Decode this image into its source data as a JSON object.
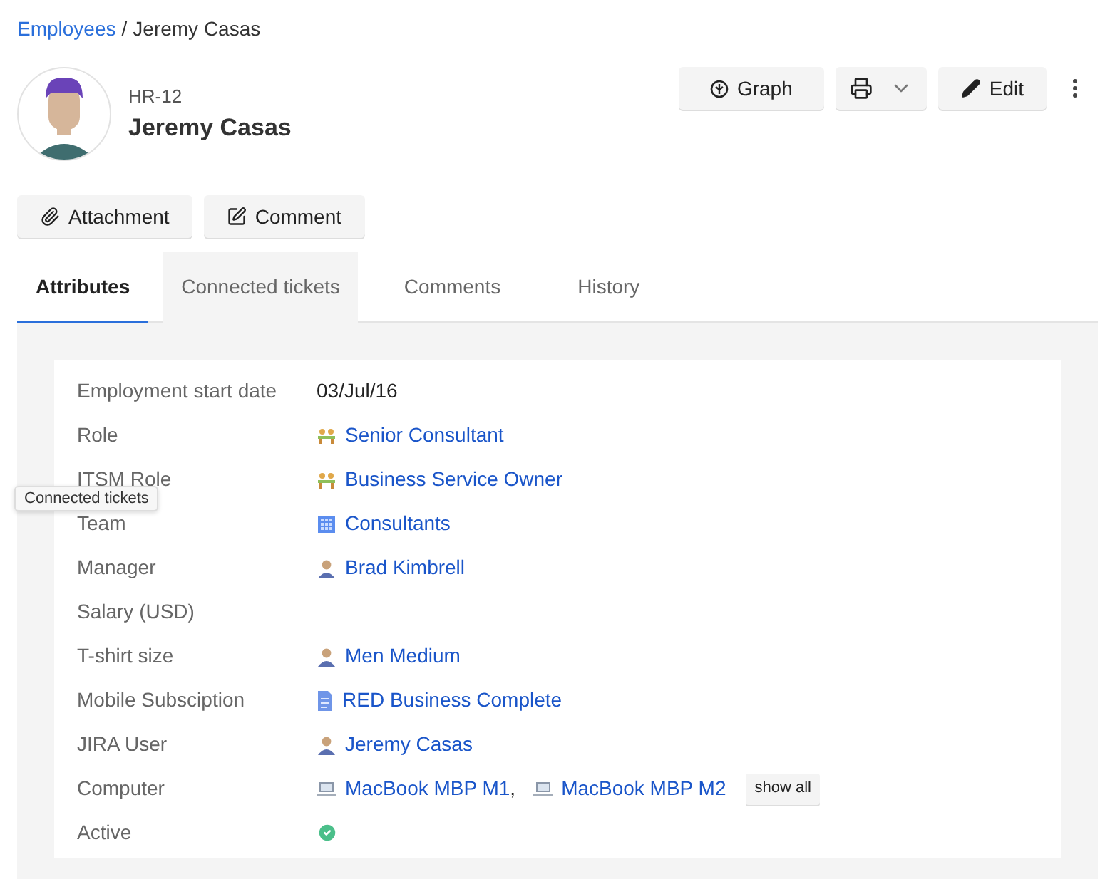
{
  "breadcrumb": {
    "link": "Employees",
    "separator": "/",
    "current": "Jeremy Casas"
  },
  "header": {
    "key": "HR-12",
    "name": "Jeremy Casas"
  },
  "toolbar": {
    "graph": "Graph",
    "edit": "Edit"
  },
  "actions": [
    "Attachment",
    "Comment"
  ],
  "tabs": [
    {
      "label": "Attributes",
      "selected": true,
      "hovered": false
    },
    {
      "label": "Connected tickets",
      "selected": false,
      "hovered": true
    },
    {
      "label": "Comments",
      "selected": false,
      "hovered": false
    },
    {
      "label": "History",
      "selected": false,
      "hovered": false
    }
  ],
  "tooltip": "Connected tickets",
  "attributes": [
    {
      "label": "Employment start date",
      "kind": "text",
      "value": "03/Jul/16"
    },
    {
      "label": "Role",
      "kind": "links",
      "links": [
        {
          "kind": "role",
          "text": "Senior Consultant"
        }
      ]
    },
    {
      "label": "ITSM Role",
      "kind": "links",
      "links": [
        {
          "kind": "role",
          "text": "Business Service Owner"
        }
      ]
    },
    {
      "label": "Team",
      "kind": "links",
      "links": [
        {
          "kind": "team",
          "text": "Consultants"
        }
      ]
    },
    {
      "label": "Manager",
      "kind": "links",
      "links": [
        {
          "kind": "person",
          "text": "Brad Kimbrell"
        }
      ]
    },
    {
      "label": "Salary (USD)",
      "kind": "empty"
    },
    {
      "label": "T-shirt size",
      "kind": "links",
      "links": [
        {
          "kind": "person",
          "text": "Men Medium"
        }
      ]
    },
    {
      "label": "Mobile Subsciption",
      "kind": "links",
      "links": [
        {
          "kind": "document",
          "text": "RED Business Complete"
        }
      ]
    },
    {
      "label": "JIRA User",
      "kind": "links",
      "links": [
        {
          "kind": "person",
          "text": "Jeremy Casas"
        }
      ]
    },
    {
      "label": "Computer",
      "kind": "links",
      "separator": ",",
      "more": "show all",
      "links": [
        {
          "kind": "computer",
          "text": "MacBook MBP M1"
        },
        {
          "kind": "computer",
          "text": "MacBook MBP M2"
        }
      ]
    },
    {
      "label": "Active",
      "kind": "check",
      "checked": true
    }
  ]
}
